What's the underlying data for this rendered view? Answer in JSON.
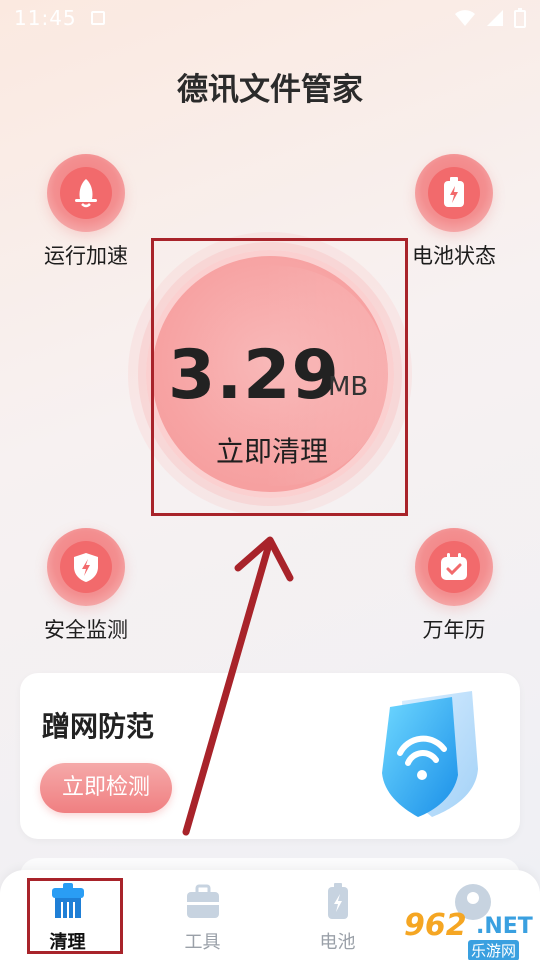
{
  "status_bar": {
    "time": "11:45"
  },
  "app": {
    "title": "德讯文件管家"
  },
  "features": {
    "speedup": "运行加速",
    "battery_status": "电池状态",
    "security": "安全监测",
    "calendar": "万年历"
  },
  "cleaner": {
    "size": "3.29",
    "unit": "MB",
    "action": "立即清理"
  },
  "card": {
    "title": "蹭网防范",
    "button": "立即检测"
  },
  "tabs": [
    {
      "label": "清理"
    },
    {
      "label": "工具"
    },
    {
      "label": "电池"
    }
  ],
  "watermark": {
    "num": "962",
    "net": ".NET",
    "sub": "乐游网"
  },
  "colors": {
    "accent": "#f26a6c",
    "highlight": "#a8232a"
  }
}
